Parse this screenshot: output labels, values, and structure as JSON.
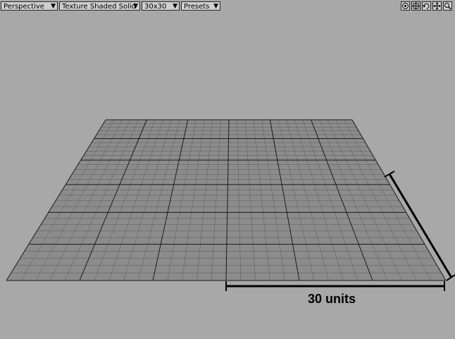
{
  "toolbar": {
    "view_mode": "Perspective",
    "shading": "Texture Shaded Solid",
    "grid_size": "30x30",
    "presets": "Presets"
  },
  "view_icons": [
    "center-view-icon",
    "fit-view-icon",
    "rotate-view-icon",
    "pan-view-icon",
    "zoom-view-icon"
  ],
  "viewport": {
    "background": "#a8a8a8",
    "grid_color": "#8c8c8c",
    "major_line_color": "#1a1a1a",
    "minor_line_color": "#5a5a5a",
    "major_divisions": 6,
    "minor_per_major": 5
  },
  "annotation": {
    "label": "30 units"
  }
}
